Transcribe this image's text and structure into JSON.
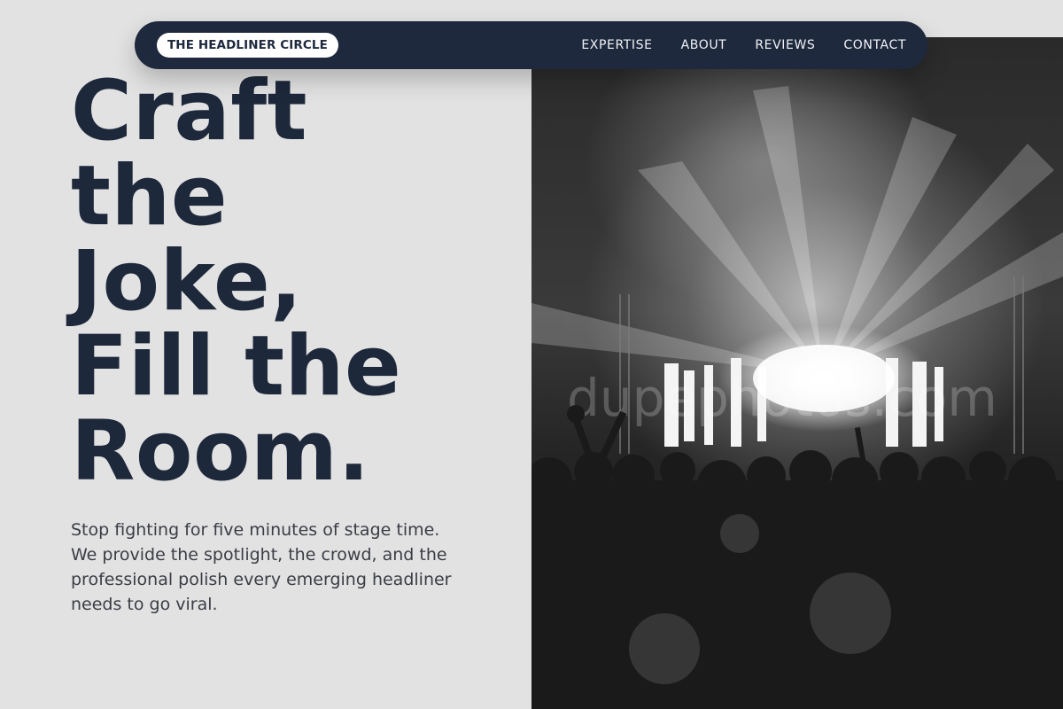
{
  "nav": {
    "brand": "THE HEADLINER CIRCLE",
    "links": [
      "EXPERTISE",
      "ABOUT",
      "REVIEWS",
      "CONTACT"
    ]
  },
  "hero": {
    "headline_lines": [
      "Craft",
      "the",
      "Joke,",
      "Fill the",
      "Room."
    ],
    "subtitle": "Stop fighting for five minutes of stage time. We provide the spotlight, the crowd, and the professional polish every emerging headliner needs to go viral.",
    "photo": "concert-crowd-image",
    "watermark": "dupephotos.com"
  },
  "colors": {
    "navy": "#1e293d",
    "background": "#e2e2e2",
    "text_dark": "#1d283b",
    "text_body": "#3a3d44"
  }
}
